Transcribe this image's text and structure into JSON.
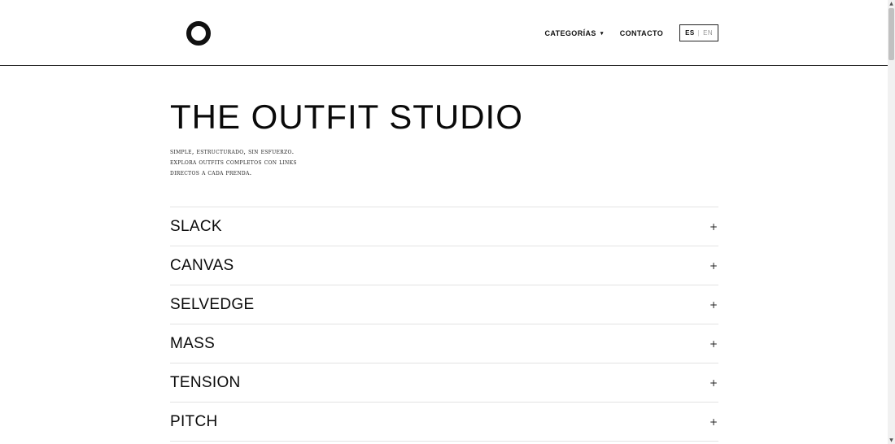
{
  "header": {
    "logo_icon": "circle-logo-icon",
    "nav": {
      "categories_label": "CATEGORÍAS",
      "categories_chevron": "▾",
      "contact_label": "CONTACTO"
    },
    "lang": {
      "active": "ES",
      "separator": "|",
      "inactive": "EN"
    }
  },
  "main": {
    "title": "THE OUTFIT STUDIO",
    "description": [
      "simple, estructurado, sin esfuerzo.",
      "explora outfits completos con links",
      "directos a cada prenda."
    ],
    "accordion": {
      "plus_symbol": "+",
      "items": [
        "SLACK",
        "CANVAS",
        "SELVEDGE",
        "MASS",
        "TENSION",
        "PITCH"
      ]
    }
  },
  "colors": {
    "text": "#111111",
    "divider": "#e3e3e3",
    "background": "#ffffff"
  }
}
